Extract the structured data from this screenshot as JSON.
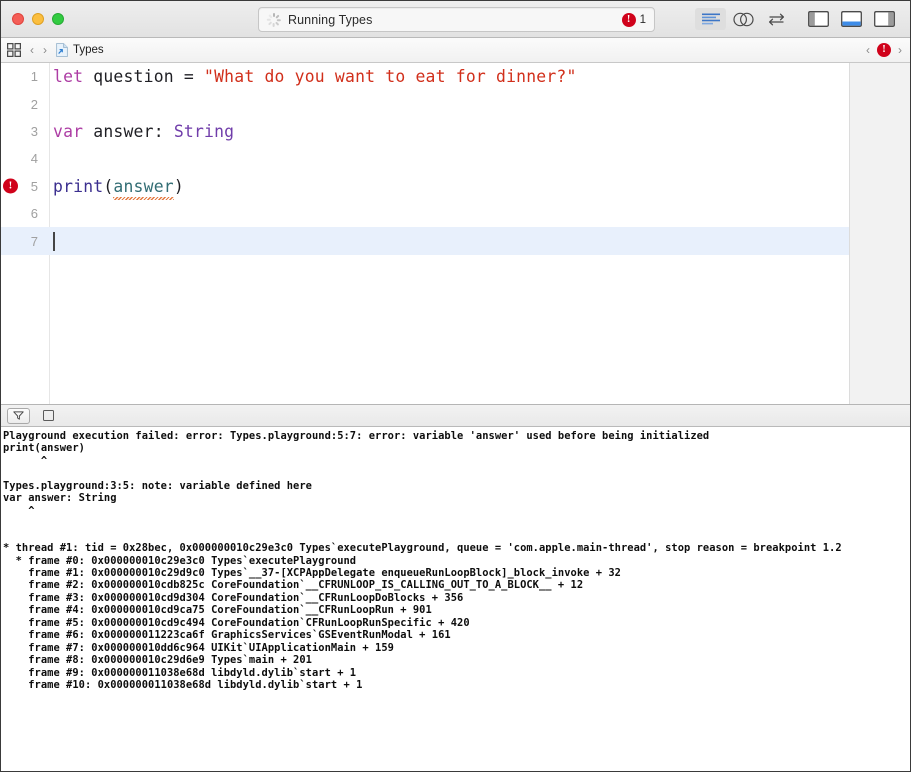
{
  "window": {
    "title": "Types",
    "traffic_lights": [
      "close-button",
      "minimize-button",
      "zoom-button"
    ]
  },
  "toolbar": {
    "activity": {
      "status_text": "Running Types",
      "spinner": "activity-spinner",
      "error_badge": "!",
      "error_count": "1"
    },
    "editor_modes": [
      {
        "name": "standard-editor-button",
        "icon": "lines-icon",
        "selected": true
      },
      {
        "name": "assistant-editor-button",
        "icon": "venn-circles-icon",
        "selected": false
      },
      {
        "name": "version-editor-button",
        "icon": "arrows-swap-icon",
        "selected": false
      }
    ],
    "panel_toggles": [
      {
        "name": "navigator-toggle-button",
        "icon": "left-panel-icon",
        "active": false
      },
      {
        "name": "debug-area-toggle-button",
        "icon": "bottom-panel-icon",
        "active": true
      },
      {
        "name": "utilities-toggle-button",
        "icon": "right-panel-icon",
        "active": false
      }
    ]
  },
  "jumpbar": {
    "grid_icon": "related-items-icon",
    "back_label": "‹",
    "forward_label": "›",
    "file_icon": "playground-file-icon",
    "file_name": "Types",
    "issue_prev_label": "‹",
    "issue_next_label": "›",
    "issue_badge": "!"
  },
  "editor": {
    "breakpoint_line": 5,
    "breakpoint_badge": "!",
    "current_line": 7,
    "lines": [
      {
        "number": "1",
        "tokens": [
          {
            "text": "let",
            "kind": "keyword"
          },
          {
            "text": " question = ",
            "kind": "plain"
          },
          {
            "text": "\"What do you want to eat for dinner?\"",
            "kind": "string"
          }
        ]
      },
      {
        "number": "2",
        "tokens": []
      },
      {
        "number": "3",
        "tokens": [
          {
            "text": "var",
            "kind": "keyword"
          },
          {
            "text": " answer: ",
            "kind": "plain"
          },
          {
            "text": "String",
            "kind": "type"
          }
        ]
      },
      {
        "number": "4",
        "tokens": []
      },
      {
        "number": "5",
        "tokens": [
          {
            "text": "print",
            "kind": "function"
          },
          {
            "text": "(",
            "kind": "plain"
          },
          {
            "text": "answer",
            "kind": "variable-error"
          },
          {
            "text": ")",
            "kind": "plain"
          }
        ]
      },
      {
        "number": "6",
        "tokens": []
      },
      {
        "number": "7",
        "tokens": [],
        "cursor": true
      }
    ]
  },
  "debug_bar": {
    "filter_button": "console-filter-button",
    "panel_button": "console-split-button"
  },
  "console": {
    "lines": [
      "Playground execution failed: error: Types.playground:5:7: error: variable 'answer' used before being initialized",
      "print(answer)",
      "      ^",
      "",
      "Types.playground:3:5: note: variable defined here",
      "var answer: String",
      "    ^",
      "",
      "",
      "* thread #1: tid = 0x28bec, 0x000000010c29e3c0 Types`executePlayground, queue = 'com.apple.main-thread', stop reason = breakpoint 1.2",
      "  * frame #0: 0x000000010c29e3c0 Types`executePlayground",
      "    frame #1: 0x000000010c29d9c0 Types`__37-[XCPAppDelegate enqueueRunLoopBlock]_block_invoke + 32",
      "    frame #2: 0x000000010cdb825c CoreFoundation`__CFRUNLOOP_IS_CALLING_OUT_TO_A_BLOCK__ + 12",
      "    frame #3: 0x000000010cd9d304 CoreFoundation`__CFRunLoopDoBlocks + 356",
      "    frame #4: 0x000000010cd9ca75 CoreFoundation`__CFRunLoopRun + 901",
      "    frame #5: 0x000000010cd9c494 CoreFoundation`CFRunLoopRunSpecific + 420",
      "    frame #6: 0x000000011223ca6f GraphicsServices`GSEventRunModal + 161",
      "    frame #7: 0x000000010dd6c964 UIKit`UIApplicationMain + 159",
      "    frame #8: 0x000000010c29d6e9 Types`main + 201",
      "    frame #9: 0x000000011038e68d libdyld.dylib`start + 1",
      "    frame #10: 0x000000011038e68d libdyld.dylib`start + 1"
    ]
  },
  "colors": {
    "keyword": "#AD3DA4",
    "string": "#D12F1B",
    "type": "#703DAA",
    "function": "#3B2F8F",
    "variable": "#326D74",
    "error_red": "#D0021B",
    "current_line": "#E8F0FC",
    "accent_blue": "#4A90E2"
  }
}
